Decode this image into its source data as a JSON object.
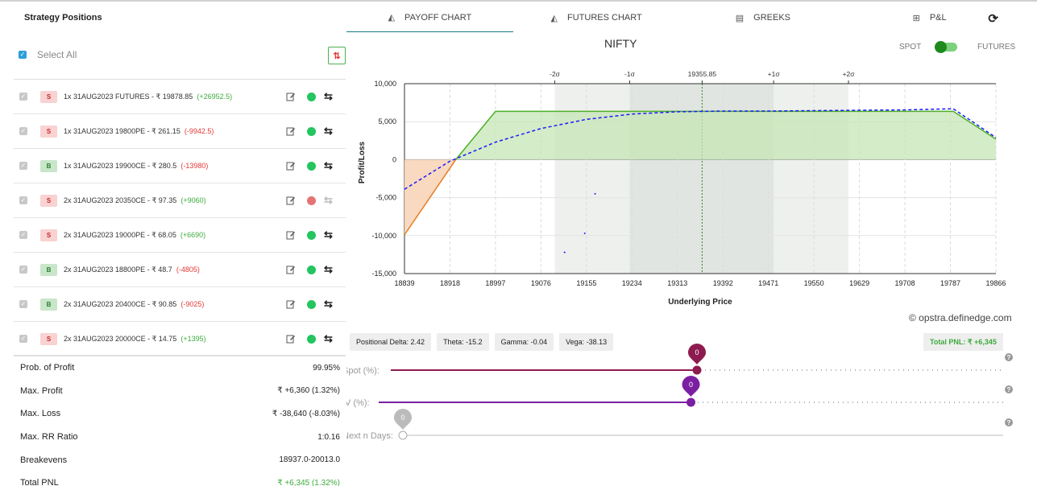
{
  "left": {
    "title": "Strategy Positions",
    "select_all": "Select All",
    "positions": [
      {
        "side": "S",
        "desc": "1x 31AUG2023 FUTURES - ₹ 19878.85",
        "pnl": "(+26952.5)",
        "pnl_sign": "pos",
        "status": "green",
        "active": true
      },
      {
        "side": "S",
        "desc": "1x 31AUG2023 19800PE - ₹ 261.15",
        "pnl": "(-9942.5)",
        "pnl_sign": "neg",
        "status": "green",
        "active": true
      },
      {
        "side": "B",
        "desc": "1x 31AUG2023 19900CE - ₹ 280.5",
        "pnl": "(-13980)",
        "pnl_sign": "neg",
        "status": "green",
        "active": true
      },
      {
        "side": "S",
        "desc": "2x 31AUG2023 20350CE - ₹ 97.35",
        "pnl": "(+9060)",
        "pnl_sign": "pos",
        "status": "red",
        "active": false
      },
      {
        "side": "S",
        "desc": "2x 31AUG2023 19000PE - ₹ 68.05",
        "pnl": "(+6690)",
        "pnl_sign": "pos",
        "status": "green",
        "active": true
      },
      {
        "side": "B",
        "desc": "2x 31AUG2023 18800PE - ₹ 48.7",
        "pnl": "(-4805)",
        "pnl_sign": "neg",
        "status": "green",
        "active": true
      },
      {
        "side": "B",
        "desc": "2x 31AUG2023 20400CE - ₹ 90.85",
        "pnl": "(-9025)",
        "pnl_sign": "neg",
        "status": "green",
        "active": true
      },
      {
        "side": "S",
        "desc": "2x 31AUG2023 20000CE - ₹ 14.75",
        "pnl": "(+1395)",
        "pnl_sign": "pos",
        "status": "green",
        "active": true
      }
    ],
    "stats": [
      {
        "label": "Prob. of Profit",
        "value": "99.95%",
        "green": false
      },
      {
        "label": "Max. Profit",
        "value": "₹ +6,360 (1.32%)",
        "green": false
      },
      {
        "label": "Max. Loss",
        "value": "₹ -38,640 (-8.03%)",
        "green": false
      },
      {
        "label": "Max. RR Ratio",
        "value": "1:0.16",
        "green": false
      },
      {
        "label": "Breakevens",
        "value": "18937.0-20013.0",
        "green": false
      },
      {
        "label": "Total PNL",
        "value": "₹ +6,345 (1.32%)",
        "green": true
      }
    ]
  },
  "tabs": [
    {
      "label": "PAYOFF CHART",
      "icon": "area-chart-icon",
      "active": true
    },
    {
      "label": "FUTURES CHART",
      "icon": "area-chart-icon",
      "active": false
    },
    {
      "label": "GREEKS",
      "icon": "list-icon",
      "active": false
    },
    {
      "label": "P&L",
      "icon": "table-icon",
      "active": false
    }
  ],
  "chart_title": "NIFTY",
  "toggle": {
    "left": "SPOT",
    "right": "FUTURES",
    "state": "spot"
  },
  "credit": "© opstra.definedge.com",
  "greeks": [
    {
      "label": "Positional Delta: 2.42"
    },
    {
      "label": "Theta: -15.2"
    },
    {
      "label": "Gamma: -0.04"
    },
    {
      "label": "Vega: -38.13"
    }
  ],
  "total_pnl": "Total PNL: ₹ +6,345",
  "sliders": [
    {
      "label": "Spot (%):",
      "value": "0",
      "color": "#8e1b4f",
      "fraction": 0.5
    },
    {
      "label": "IV (%):",
      "value": "0",
      "color": "#7b1fa2",
      "fraction": 0.5
    },
    {
      "label": "Next n Days:",
      "value": "0",
      "color": "#bbbbbb",
      "fraction": 0.0
    }
  ],
  "chart_data": {
    "type": "line",
    "xlabel": "Underlying Price",
    "ylabel": "Profit/Loss",
    "x_ticks": [
      "18839",
      "18918",
      "18997",
      "19076",
      "19155",
      "19234",
      "19313",
      "19392",
      "19471",
      "19550",
      "19629",
      "19708",
      "19787",
      "19866"
    ],
    "y_ticks": [
      "10,000",
      "5,000",
      "0",
      "-5,000",
      "-10,000",
      "-15,000"
    ],
    "ylim": [
      -15000,
      10000
    ],
    "xlim": [
      18839,
      19866
    ],
    "top_markers": [
      "-2σ",
      "-1σ",
      "19355.85",
      "+1σ",
      "+2σ"
    ],
    "top_marker_x": [
      19100,
      19230,
      19355.85,
      19480,
      19610
    ],
    "band_2sigma": [
      19100,
      19610
    ],
    "band_1sigma": [
      19230,
      19480
    ],
    "spot": 19355.85,
    "series": [
      {
        "style": "solid",
        "x": [
          18839,
          18928,
          18997,
          19792,
          19866
        ],
        "y": [
          -9900,
          0,
          6360,
          6360,
          2700
        ]
      },
      {
        "style": "dashed",
        "x": [
          18839,
          18918,
          18997,
          19076,
          19155,
          19234,
          19313,
          19392,
          19471,
          19550,
          19629,
          19708,
          19792,
          19866
        ],
        "y": [
          -3900,
          -200,
          2300,
          4100,
          5300,
          6000,
          6300,
          6400,
          6400,
          6450,
          6500,
          6550,
          6700,
          2900
        ]
      }
    ],
    "scatter": [
      {
        "x": 19170,
        "y": -4500
      },
      {
        "x": 19152,
        "y": -9700
      },
      {
        "x": 19117,
        "y": -12200
      }
    ]
  }
}
